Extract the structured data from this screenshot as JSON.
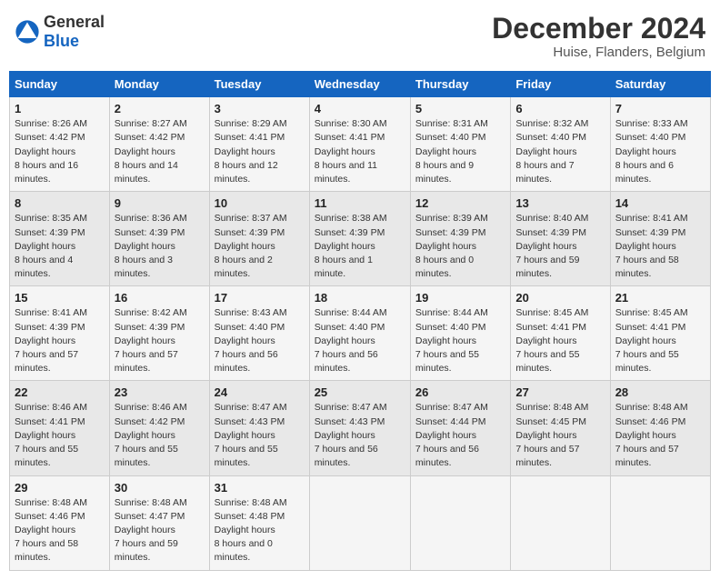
{
  "header": {
    "logo_general": "General",
    "logo_blue": "Blue",
    "month_title": "December 2024",
    "location": "Huise, Flanders, Belgium"
  },
  "weekdays": [
    "Sunday",
    "Monday",
    "Tuesday",
    "Wednesday",
    "Thursday",
    "Friday",
    "Saturday"
  ],
  "weeks": [
    [
      {
        "day": "1",
        "sunrise": "8:26 AM",
        "sunset": "4:42 PM",
        "daylight": "8 hours and 16 minutes."
      },
      {
        "day": "2",
        "sunrise": "8:27 AM",
        "sunset": "4:42 PM",
        "daylight": "8 hours and 14 minutes."
      },
      {
        "day": "3",
        "sunrise": "8:29 AM",
        "sunset": "4:41 PM",
        "daylight": "8 hours and 12 minutes."
      },
      {
        "day": "4",
        "sunrise": "8:30 AM",
        "sunset": "4:41 PM",
        "daylight": "8 hours and 11 minutes."
      },
      {
        "day": "5",
        "sunrise": "8:31 AM",
        "sunset": "4:40 PM",
        "daylight": "8 hours and 9 minutes."
      },
      {
        "day": "6",
        "sunrise": "8:32 AM",
        "sunset": "4:40 PM",
        "daylight": "8 hours and 7 minutes."
      },
      {
        "day": "7",
        "sunrise": "8:33 AM",
        "sunset": "4:40 PM",
        "daylight": "8 hours and 6 minutes."
      }
    ],
    [
      {
        "day": "8",
        "sunrise": "8:35 AM",
        "sunset": "4:39 PM",
        "daylight": "8 hours and 4 minutes."
      },
      {
        "day": "9",
        "sunrise": "8:36 AM",
        "sunset": "4:39 PM",
        "daylight": "8 hours and 3 minutes."
      },
      {
        "day": "10",
        "sunrise": "8:37 AM",
        "sunset": "4:39 PM",
        "daylight": "8 hours and 2 minutes."
      },
      {
        "day": "11",
        "sunrise": "8:38 AM",
        "sunset": "4:39 PM",
        "daylight": "8 hours and 1 minute."
      },
      {
        "day": "12",
        "sunrise": "8:39 AM",
        "sunset": "4:39 PM",
        "daylight": "8 hours and 0 minutes."
      },
      {
        "day": "13",
        "sunrise": "8:40 AM",
        "sunset": "4:39 PM",
        "daylight": "7 hours and 59 minutes."
      },
      {
        "day": "14",
        "sunrise": "8:41 AM",
        "sunset": "4:39 PM",
        "daylight": "7 hours and 58 minutes."
      }
    ],
    [
      {
        "day": "15",
        "sunrise": "8:41 AM",
        "sunset": "4:39 PM",
        "daylight": "7 hours and 57 minutes."
      },
      {
        "day": "16",
        "sunrise": "8:42 AM",
        "sunset": "4:39 PM",
        "daylight": "7 hours and 57 minutes."
      },
      {
        "day": "17",
        "sunrise": "8:43 AM",
        "sunset": "4:40 PM",
        "daylight": "7 hours and 56 minutes."
      },
      {
        "day": "18",
        "sunrise": "8:44 AM",
        "sunset": "4:40 PM",
        "daylight": "7 hours and 56 minutes."
      },
      {
        "day": "19",
        "sunrise": "8:44 AM",
        "sunset": "4:40 PM",
        "daylight": "7 hours and 55 minutes."
      },
      {
        "day": "20",
        "sunrise": "8:45 AM",
        "sunset": "4:41 PM",
        "daylight": "7 hours and 55 minutes."
      },
      {
        "day": "21",
        "sunrise": "8:45 AM",
        "sunset": "4:41 PM",
        "daylight": "7 hours and 55 minutes."
      }
    ],
    [
      {
        "day": "22",
        "sunrise": "8:46 AM",
        "sunset": "4:41 PM",
        "daylight": "7 hours and 55 minutes."
      },
      {
        "day": "23",
        "sunrise": "8:46 AM",
        "sunset": "4:42 PM",
        "daylight": "7 hours and 55 minutes."
      },
      {
        "day": "24",
        "sunrise": "8:47 AM",
        "sunset": "4:43 PM",
        "daylight": "7 hours and 55 minutes."
      },
      {
        "day": "25",
        "sunrise": "8:47 AM",
        "sunset": "4:43 PM",
        "daylight": "7 hours and 56 minutes."
      },
      {
        "day": "26",
        "sunrise": "8:47 AM",
        "sunset": "4:44 PM",
        "daylight": "7 hours and 56 minutes."
      },
      {
        "day": "27",
        "sunrise": "8:48 AM",
        "sunset": "4:45 PM",
        "daylight": "7 hours and 57 minutes."
      },
      {
        "day": "28",
        "sunrise": "8:48 AM",
        "sunset": "4:46 PM",
        "daylight": "7 hours and 57 minutes."
      }
    ],
    [
      {
        "day": "29",
        "sunrise": "8:48 AM",
        "sunset": "4:46 PM",
        "daylight": "7 hours and 58 minutes."
      },
      {
        "day": "30",
        "sunrise": "8:48 AM",
        "sunset": "4:47 PM",
        "daylight": "7 hours and 59 minutes."
      },
      {
        "day": "31",
        "sunrise": "8:48 AM",
        "sunset": "4:48 PM",
        "daylight": "8 hours and 0 minutes."
      },
      null,
      null,
      null,
      null
    ]
  ]
}
